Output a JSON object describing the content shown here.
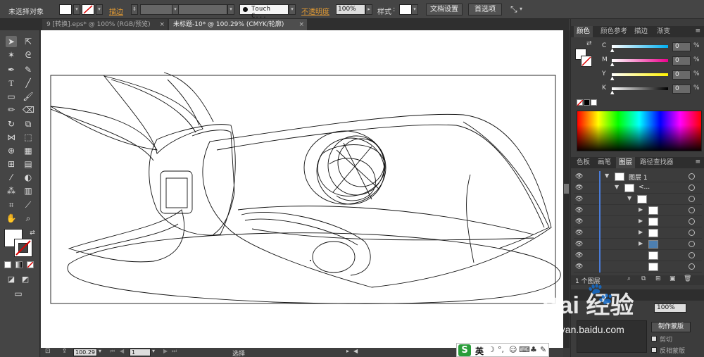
{
  "control_bar": {
    "selection_status": "未选择对象",
    "stroke_label": "描边",
    "brush_name": "Touch C...",
    "opacity_label": "不透明度",
    "opacity_value": "100%",
    "style_label": "样式",
    "doc_setup_button": "文档设置",
    "preferences_button": "首选项"
  },
  "document_tabs": [
    {
      "label": "9 [转换].eps* @ 100% (RGB/预览)",
      "close": "×"
    },
    {
      "label": "未标题-10* @ 100.29% (CMYK/轮廓)",
      "close": "×"
    }
  ],
  "color_panel": {
    "tabs": [
      "颜色",
      "颜色参考",
      "描边",
      "渐变"
    ],
    "channels": [
      {
        "name": "C",
        "value": "0",
        "unit": "%",
        "color": "#00aeef"
      },
      {
        "name": "M",
        "value": "0",
        "unit": "%",
        "color": "#ec008c"
      },
      {
        "name": "Y",
        "value": "0",
        "unit": "%",
        "color": "#fff200"
      },
      {
        "name": "K",
        "value": "0",
        "unit": "%",
        "color": "#000000"
      }
    ]
  },
  "layers_panel": {
    "tabs": [
      "色板",
      "画笔",
      "图层",
      "路径查找器"
    ],
    "top_layer_name": "图层 1",
    "group_name": "<...",
    "layer_count": "1 个图层"
  },
  "transparency_panel": {
    "opacity_value": "100%",
    "make_mask_button": "制作蒙版",
    "clip_label": "剪切",
    "invert_mask_label": "反相蒙版"
  },
  "status_bar": {
    "zoom": "100.29",
    "artboard": "1",
    "tool_status": "选择"
  },
  "ime_bar": {
    "logo": "S",
    "mode": "英"
  },
  "watermark": {
    "brand": "Bai  经验",
    "url": "jingyan.baidu.com"
  }
}
